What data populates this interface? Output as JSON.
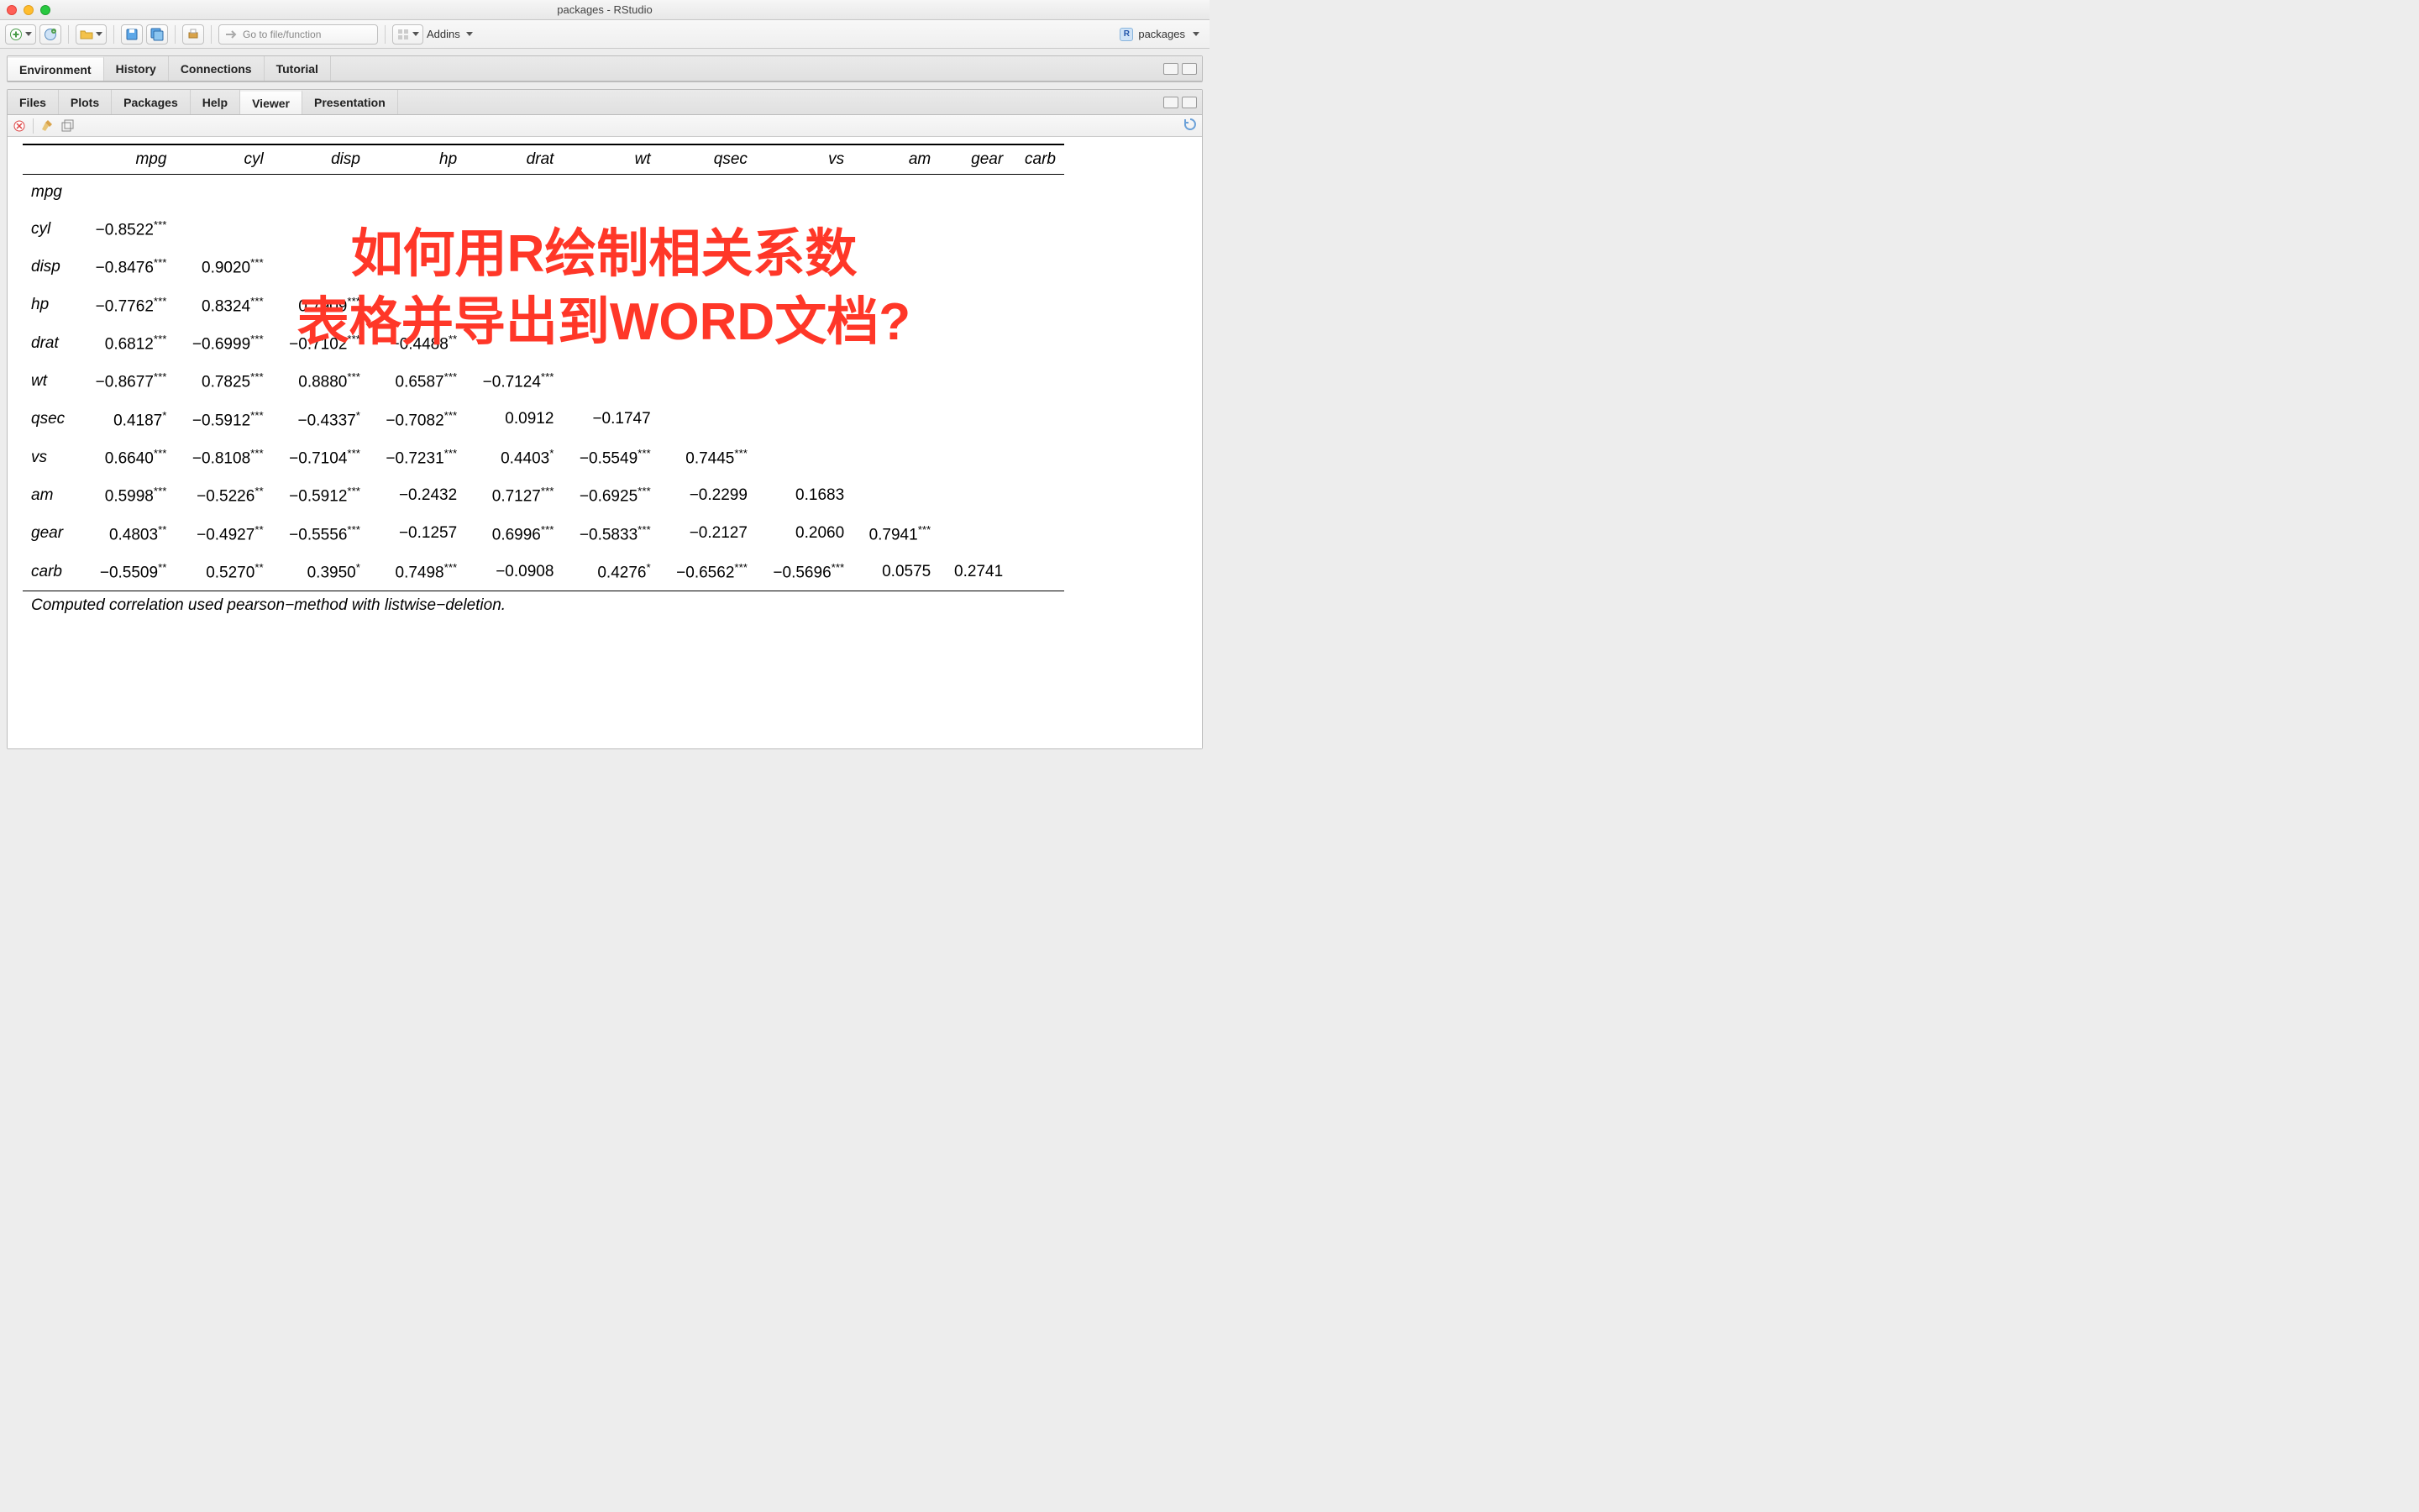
{
  "window": {
    "title": "packages - RStudio"
  },
  "toolbar": {
    "goto_placeholder": "Go to file/function",
    "addins_label": "Addins"
  },
  "project": {
    "name": "packages"
  },
  "panes": {
    "top": {
      "tabs": [
        "Environment",
        "History",
        "Connections",
        "Tutorial"
      ],
      "active": 0
    },
    "bottom": {
      "tabs": [
        "Files",
        "Plots",
        "Packages",
        "Help",
        "Viewer",
        "Presentation"
      ],
      "active": 4
    }
  },
  "corr": {
    "vars": [
      "mpg",
      "cyl",
      "disp",
      "hp",
      "drat",
      "wt",
      "qsec",
      "vs",
      "am",
      "gear",
      "carb"
    ],
    "rows": [
      {
        "name": "mpg",
        "cells": []
      },
      {
        "name": "cyl",
        "cells": [
          {
            "v": "−0.8522",
            "s": "***"
          }
        ]
      },
      {
        "name": "disp",
        "cells": [
          {
            "v": "−0.8476",
            "s": "***"
          },
          {
            "v": "0.9020",
            "s": "***"
          }
        ]
      },
      {
        "name": "hp",
        "cells": [
          {
            "v": "−0.7762",
            "s": "***"
          },
          {
            "v": "0.8324",
            "s": "***"
          },
          {
            "v": "0.7909",
            "s": "***"
          }
        ]
      },
      {
        "name": "drat",
        "cells": [
          {
            "v": "0.6812",
            "s": "***"
          },
          {
            "v": "−0.6999",
            "s": "***"
          },
          {
            "v": "−0.7102",
            "s": "***"
          },
          {
            "v": "−0.4488",
            "s": "**"
          }
        ]
      },
      {
        "name": "wt",
        "cells": [
          {
            "v": "−0.8677",
            "s": "***"
          },
          {
            "v": "0.7825",
            "s": "***"
          },
          {
            "v": "0.8880",
            "s": "***"
          },
          {
            "v": "0.6587",
            "s": "***"
          },
          {
            "v": "−0.7124",
            "s": "***"
          }
        ]
      },
      {
        "name": "qsec",
        "cells": [
          {
            "v": "0.4187",
            "s": "*"
          },
          {
            "v": "−0.5912",
            "s": "***"
          },
          {
            "v": "−0.4337",
            "s": "*"
          },
          {
            "v": "−0.7082",
            "s": "***"
          },
          {
            "v": "0.0912",
            "s": ""
          },
          {
            "v": "−0.1747",
            "s": ""
          }
        ]
      },
      {
        "name": "vs",
        "cells": [
          {
            "v": "0.6640",
            "s": "***"
          },
          {
            "v": "−0.8108",
            "s": "***"
          },
          {
            "v": "−0.7104",
            "s": "***"
          },
          {
            "v": "−0.7231",
            "s": "***"
          },
          {
            "v": "0.4403",
            "s": "*"
          },
          {
            "v": "−0.5549",
            "s": "***"
          },
          {
            "v": "0.7445",
            "s": "***"
          }
        ]
      },
      {
        "name": "am",
        "cells": [
          {
            "v": "0.5998",
            "s": "***"
          },
          {
            "v": "−0.5226",
            "s": "**"
          },
          {
            "v": "−0.5912",
            "s": "***"
          },
          {
            "v": "−0.2432",
            "s": ""
          },
          {
            "v": "0.7127",
            "s": "***"
          },
          {
            "v": "−0.6925",
            "s": "***"
          },
          {
            "v": "−0.2299",
            "s": ""
          },
          {
            "v": "0.1683",
            "s": ""
          }
        ]
      },
      {
        "name": "gear",
        "cells": [
          {
            "v": "0.4803",
            "s": "**"
          },
          {
            "v": "−0.4927",
            "s": "**"
          },
          {
            "v": "−0.5556",
            "s": "***"
          },
          {
            "v": "−0.1257",
            "s": ""
          },
          {
            "v": "0.6996",
            "s": "***"
          },
          {
            "v": "−0.5833",
            "s": "***"
          },
          {
            "v": "−0.2127",
            "s": ""
          },
          {
            "v": "0.2060",
            "s": ""
          },
          {
            "v": "0.7941",
            "s": "***"
          }
        ]
      },
      {
        "name": "carb",
        "cells": [
          {
            "v": "−0.5509",
            "s": "**"
          },
          {
            "v": "0.5270",
            "s": "**"
          },
          {
            "v": "0.3950",
            "s": "*"
          },
          {
            "v": "0.7498",
            "s": "***"
          },
          {
            "v": "−0.0908",
            "s": ""
          },
          {
            "v": "0.4276",
            "s": "*"
          },
          {
            "v": "−0.6562",
            "s": "***"
          },
          {
            "v": "−0.5696",
            "s": "***"
          },
          {
            "v": "0.0575",
            "s": ""
          },
          {
            "v": "0.2741",
            "s": ""
          }
        ]
      }
    ],
    "note": "Computed correlation used pearson−method with listwise−deletion."
  },
  "overlay": {
    "line1": "如何用R绘制相关系数",
    "line2": "表格并导出到WORD文档?"
  }
}
